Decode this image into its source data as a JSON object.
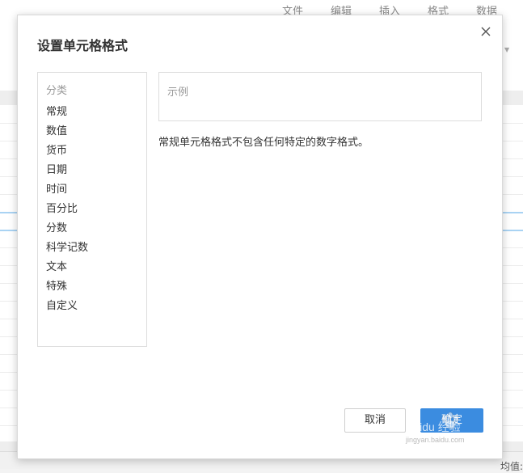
{
  "menubar": {
    "items": [
      "文件",
      "编辑",
      "插入",
      "格式",
      "数据"
    ]
  },
  "statusbar": {
    "text": "均值:"
  },
  "dialog": {
    "title": "设置单元格格式",
    "category_header": "分类",
    "categories": [
      "常规",
      "数值",
      "货币",
      "日期",
      "时间",
      "百分比",
      "分数",
      "科学记数",
      "文本",
      "特殊",
      "自定义"
    ],
    "preview_label": "示例",
    "description": "常规单元格格式不包含任何特定的数字格式。",
    "cancel_label": "取消",
    "ok_label": "确定"
  },
  "colors": {
    "accent": "#3b8ce0",
    "selection_line": "#a9d3f3"
  },
  "watermark": {
    "text": "Baidu 经验",
    "subtext": "jingyan.baidu.com"
  }
}
